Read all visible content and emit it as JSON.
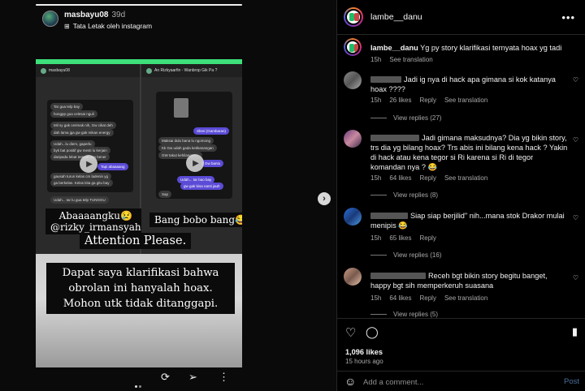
{
  "story": {
    "progress": 1.0,
    "username": "masbayu08",
    "time": "39d",
    "layout_label": "Tata Letak oleh instagram",
    "chat1": {
      "header": "masbayu08",
      "bubbles": [
        "Tar gua telp bay",
        "hongpp gua celesai nguli",
        "Mil sy gak cerimak nih, Gw cikat deh",
        "dah lama jga gw gak mikan energy",
        "Udah...lu diem, gaperlu",
        "byk bat positif gw mesti lu kerjain",
        "daripada lebat tempat kan bener",
        "Tapi abaaaang",
        "gausah turun kelas cm ladenin yg",
        "ga berkelas. Kelas kita ga gitu bay",
        "Udah... tar lu gua telp TUNGGU"
      ],
      "caption_line1": "Abaaaangku😢",
      "caption_line2": "@rizky_irmansyah"
    },
    "chat2": {
      "header": "An Rizkyaarfin - Wanbrop Gik Pa ?",
      "bubbles": [
        "Sbrei (Gambaran)",
        "Maksai dulu bana lu ngomong",
        "Kk Gw udah gada ketikanangan",
        "GW takut kehilangan...",
        "Gw bantu",
        "Udah... tar bao bay",
        "gw gak bisa nanti jauh",
        "Sap"
      ],
      "caption": "Bang bobo bang😂"
    },
    "attention": "Attention Please.",
    "clarification": "Dapat saya klarifikasi bahwa obrolan ini hanyalah hoax. Mohon utk tidak ditanggapi."
  },
  "post": {
    "username": "lambe__danu",
    "caption_user": "lambe__danu",
    "caption_text": "Yg py story klarifikasi ternyata hoax yg tadi",
    "caption_time": "15h",
    "see_translation": "See translation",
    "comments": [
      {
        "text": "Jadi ig nya di hack apa gimana si kok katanya hoax ????",
        "time": "15h",
        "likes": "26 likes",
        "reply": "Reply",
        "translation": "See translation",
        "view_replies": "View replies (27)"
      },
      {
        "text": "Jadi gimana maksudnya? Dia yg bikin story, trs dia yg bilang hoax? Trs abis ini bilang kena hack ? Yakin di hack atau kena tegor si Ri karena si Ri di tegor komandan nya ? 😂",
        "time": "15h",
        "likes": "64 likes",
        "reply": "Reply",
        "translation": "See translation",
        "view_replies": "View replies (8)"
      },
      {
        "text": "Siap siap berjilid\" nih...mana stok Drakor mulai menipis 😂",
        "time": "15h",
        "likes": "65 likes",
        "reply": "Reply",
        "translation": "",
        "view_replies": "View replies (16)"
      },
      {
        "text": "Receh bgt bikin story begitu banget, happy bgt sih memperkeruh suasana",
        "time": "15h",
        "likes": "64 likes",
        "reply": "Reply",
        "translation": "See translation",
        "view_replies": "View replies (5)"
      }
    ],
    "likes": "1,096 likes",
    "ago": "15 hours ago",
    "comment_placeholder": "Add a comment...",
    "post_label": "Post"
  },
  "colors": {
    "accent_link": "#4a6f9a",
    "story_greenbar": "#3de07a",
    "dm_bubble": "#5b4bd6"
  }
}
